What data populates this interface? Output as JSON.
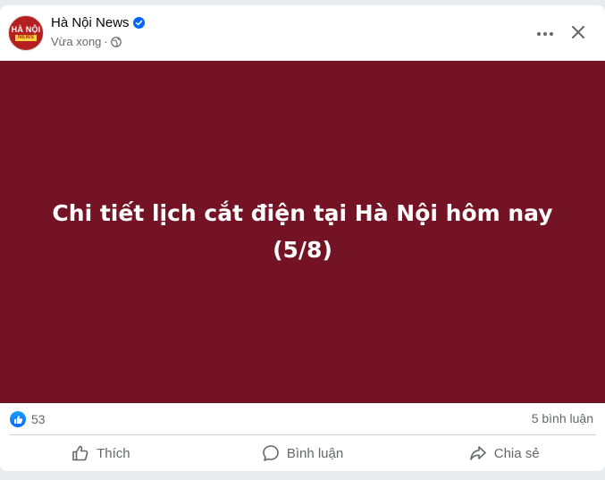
{
  "post": {
    "page_name": "Hà Nội News",
    "avatar_line1": "HÀ NỘI",
    "avatar_line2": "NEWS",
    "time": "Vừa xong",
    "separator": "·",
    "audience_icon": "globe-icon",
    "verified_icon": "verified-badge-icon",
    "headline": "Chi tiết lịch cắt điện tại Hà Nội hôm nay (5/8)",
    "image_background": "#731324"
  },
  "stats": {
    "reaction_icon": "like-reaction-icon",
    "reactions": "53",
    "comments": "5 bình luận"
  },
  "actions": {
    "like_label": "Thích",
    "comment_label": "Bình luận",
    "share_label": "Chia sẻ"
  },
  "colors": {
    "accent": "#0866ff",
    "secondary_text": "#65676b"
  }
}
